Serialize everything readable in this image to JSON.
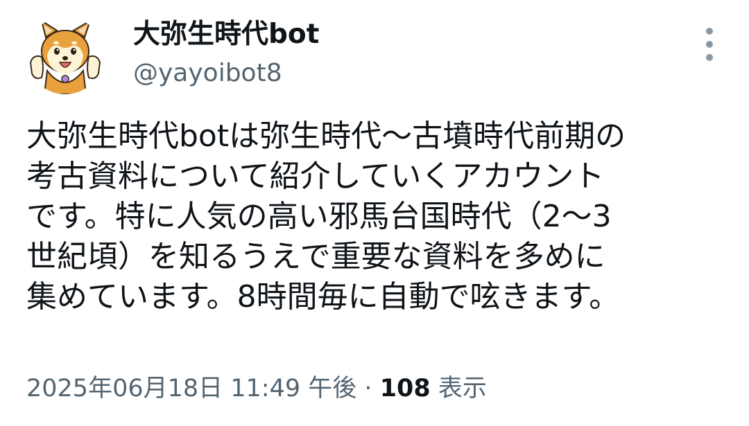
{
  "author": {
    "display_name": "大弥生時代bot",
    "handle": "@yayoibot8",
    "avatar_icon": "shiba-dog-mascot-icon"
  },
  "more_icon": "more-vertical-icon",
  "tweet": {
    "text_lines": [
      "大弥生時代botは弥生時代〜古墳時代前期の",
      "考古資料について紹介していくアカウント",
      "です。特に人気の高い邪馬台国時代（2〜3",
      "世紀頃）を知るうえで重要な資料を多めに",
      "集めています。8時間毎に自動で呟きます。"
    ]
  },
  "meta": {
    "timestamp": "2025年06月18日 11:49 午後",
    "separator": "·",
    "views_count": "108",
    "views_label": "表示"
  },
  "colors": {
    "text_primary": "#0f1419",
    "text_secondary": "#536471",
    "dog_orange": "#e8a13c",
    "dog_cream": "#fdf3d6"
  }
}
